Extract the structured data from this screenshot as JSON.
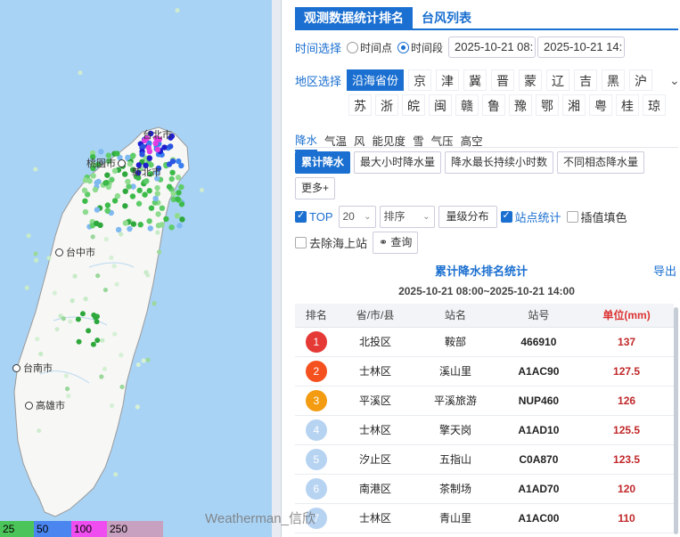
{
  "map": {
    "cities": [
      {
        "name": "台北市"
      },
      {
        "name": "桃園市"
      },
      {
        "name": "新北市"
      },
      {
        "name": "台中市"
      },
      {
        "name": "台南市"
      },
      {
        "name": "高雄市"
      }
    ],
    "legend": [
      {
        "label": "25",
        "color": "#4bc45a"
      },
      {
        "label": "50",
        "color": "#4b86f0"
      },
      {
        "label": "100",
        "color": "#f04df0"
      },
      {
        "label": "250",
        "color": "#8a1a5a"
      }
    ]
  },
  "panel": {
    "tabs": [
      "观测数据统计排名",
      "台风列表"
    ],
    "time": {
      "label": "时间选择",
      "options": [
        "时间点",
        "时间段"
      ],
      "selected": "时间段",
      "start": "2025-10-21 08:",
      "end": "2025-10-21 14:"
    },
    "region": {
      "label": "地区选择",
      "active": "沿海省份",
      "row1": [
        "京",
        "津",
        "冀",
        "晋",
        "蒙",
        "辽",
        "吉",
        "黑",
        "沪"
      ],
      "row2": [
        "苏",
        "浙",
        "皖",
        "闽",
        "赣",
        "鲁",
        "豫",
        "鄂",
        "湘",
        "粤",
        "桂",
        "琼"
      ]
    },
    "elements": [
      "降水",
      "气温",
      "风",
      "能见度",
      "雪",
      "气压",
      "高空"
    ],
    "active_element": "降水",
    "stat_buttons": [
      "累计降水",
      "最大小时降水量",
      "降水最长持续小时数",
      "不同相态降水量"
    ],
    "more_button": "更多+",
    "options": {
      "top_label": "TOP",
      "top_value": "20",
      "sort_label": "排序",
      "grade_label": "量级分布",
      "station_stat": "站点统计",
      "interp_fill": "插值填色",
      "remove_sea": "去除海上站",
      "query": "查询"
    },
    "result": {
      "title": "累计降水排名统计",
      "export": "导出",
      "period": "2025-10-21 08:00~2025-10-21 14:00",
      "columns": [
        "排名",
        "省/市/县",
        "站名",
        "站号",
        "单位(mm)"
      ],
      "rows": [
        {
          "rank": "1",
          "county": "北投区",
          "station": "鞍部",
          "id": "466910",
          "value": "137",
          "color": "#e53935"
        },
        {
          "rank": "2",
          "county": "士林区",
          "station": "溪山里",
          "id": "A1AC90",
          "value": "127.5",
          "color": "#f4511e"
        },
        {
          "rank": "3",
          "county": "平溪区",
          "station": "平溪旅游",
          "id": "NUP460",
          "value": "126",
          "color": "#f39c12"
        },
        {
          "rank": "4",
          "county": "士林区",
          "station": "擎天岗",
          "id": "A1AD10",
          "value": "125.5",
          "color": "#b7d3f2"
        },
        {
          "rank": "5",
          "county": "汐止区",
          "station": "五指山",
          "id": "C0A870",
          "value": "123.5",
          "color": "#b7d3f2"
        },
        {
          "rank": "6",
          "county": "南港区",
          "station": "茶制场",
          "id": "A1AD70",
          "value": "120",
          "color": "#b7d3f2"
        },
        {
          "rank": "7",
          "county": "士林区",
          "station": "青山里",
          "id": "A1AC00",
          "value": "110",
          "color": "#b7d3f2"
        }
      ]
    }
  },
  "watermark": "Weatherman_信欣"
}
